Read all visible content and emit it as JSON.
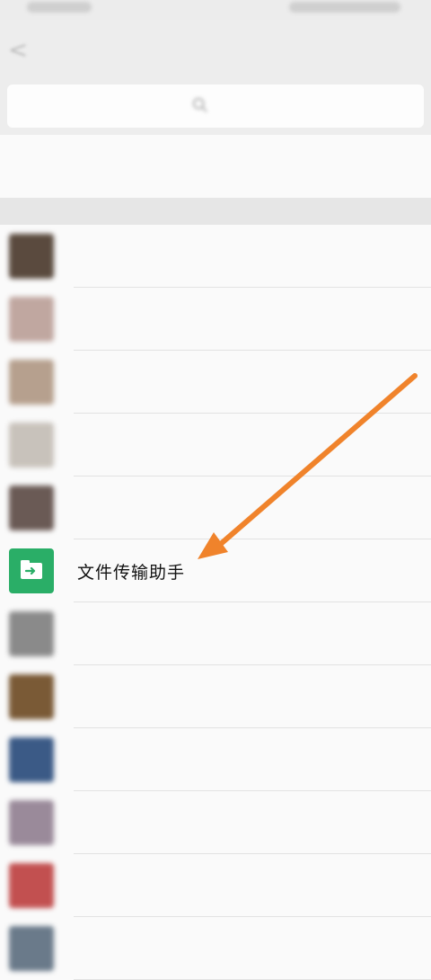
{
  "contacts": [
    {
      "name": "",
      "avatar_color": "#5a4a3e",
      "blur": true
    },
    {
      "name": "",
      "avatar_color": "#c0a7a0",
      "blur": true
    },
    {
      "name": "",
      "avatar_color": "#b6a08e",
      "blur": true
    },
    {
      "name": "",
      "avatar_color": "#c8c2bb",
      "blur": true
    },
    {
      "name": "",
      "avatar_color": "#6a5a55",
      "blur": true
    },
    {
      "name": "文件传输助手",
      "avatar_color": "#2aae67",
      "blur": false
    },
    {
      "name": "",
      "avatar_color": "#8a8a8a",
      "blur": true
    },
    {
      "name": "",
      "avatar_color": "#7a5a36",
      "blur": true
    },
    {
      "name": "",
      "avatar_color": "#3b5a86",
      "blur": true
    },
    {
      "name": "",
      "avatar_color": "#9a8a9a",
      "blur": true
    },
    {
      "name": "",
      "avatar_color": "#c25050",
      "blur": true
    },
    {
      "name": "",
      "avatar_color": "#6a7a8a",
      "blur": true
    }
  ],
  "colors": {
    "annotation_arrow": "#f0832b",
    "file_transfer_green": "#2aae67",
    "list_bg": "#fafafa",
    "page_bg": "#f2f2f2"
  },
  "icons": {
    "back": "back-icon",
    "search": "search-icon",
    "file_transfer": "file-transfer-icon"
  }
}
